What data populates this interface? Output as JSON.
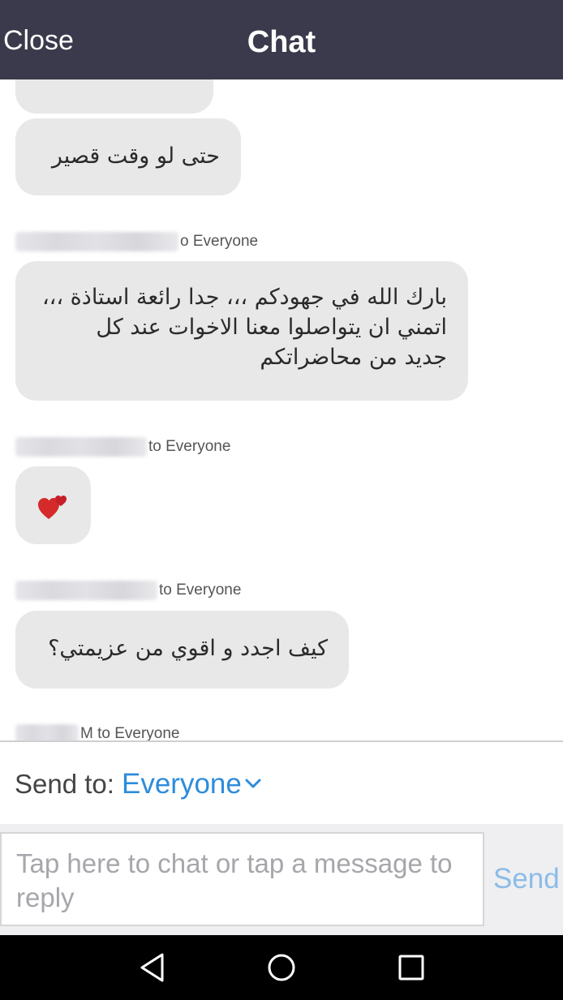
{
  "header": {
    "close_label": "Close",
    "title": "Chat"
  },
  "messages": [
    {
      "text": "حتى لو وقت قصير"
    },
    {
      "recipient": "o Everyone",
      "text": "بارك الله في جهودكم ،،، جدا رائعة استاذة ،،،\nاتمني ان يتواصلوا معنا الاخوات عند كل\nجديد من محاضراتكم"
    },
    {
      "recipient": "to Everyone",
      "emoji": "two-hearts"
    },
    {
      "recipient": "to Everyone",
      "text": "كيف اجدد و اقوي من عزيمتي؟"
    },
    {
      "recipient": "M to Everyone"
    }
  ],
  "send_to": {
    "label": "Send to:",
    "value": "Everyone",
    "icon": "chevron-down-icon"
  },
  "composer": {
    "placeholder": "Tap here to chat or tap a message to reply",
    "send_label": "Send"
  },
  "navbar": {
    "icons": [
      "back-icon",
      "home-icon",
      "recents-icon"
    ]
  },
  "colors": {
    "header_bg": "#3b3a4c",
    "bubble_bg": "#e8e8e8",
    "accent": "#2d8cdb",
    "send_disabled": "#8cbce8"
  }
}
